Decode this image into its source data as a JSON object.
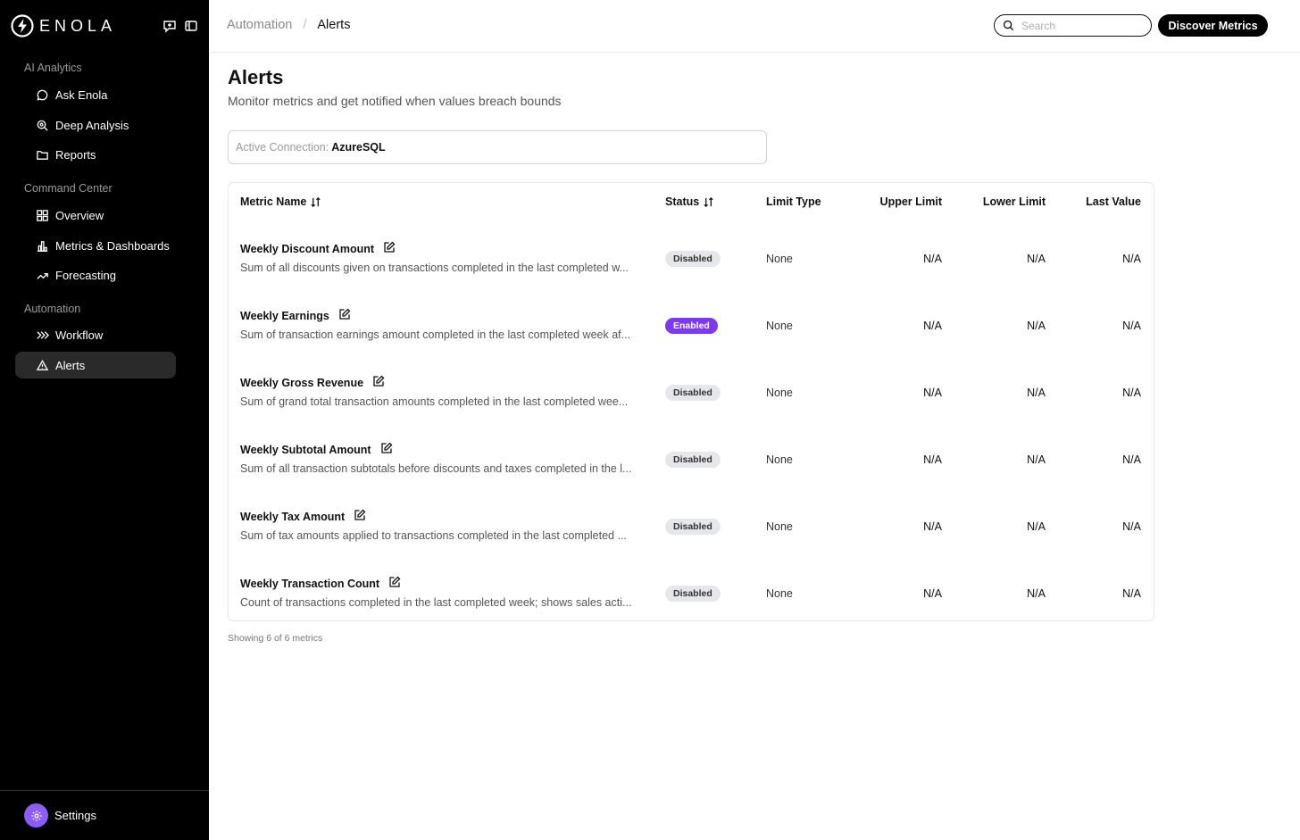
{
  "brand": {
    "name": "ENOLA"
  },
  "sidebar": {
    "sections": [
      {
        "title": "AI Analytics",
        "items": [
          {
            "label": "Ask Enola",
            "icon": "chat-bubble-icon"
          },
          {
            "label": "Deep Analysis",
            "icon": "search-analysis-icon"
          },
          {
            "label": "Reports",
            "icon": "folder-icon"
          }
        ]
      },
      {
        "title": "Command Center",
        "items": [
          {
            "label": "Overview",
            "icon": "grid-icon"
          },
          {
            "label": "Metrics & Dashboards",
            "icon": "bar-chart-icon"
          },
          {
            "label": "Forecasting",
            "icon": "trend-up-icon"
          }
        ]
      },
      {
        "title": "Automation",
        "items": [
          {
            "label": "Workflow",
            "icon": "chevrons-right-icon"
          },
          {
            "label": "Alerts",
            "icon": "warning-triangle-icon",
            "active": true
          }
        ]
      }
    ],
    "settings_label": "Settings"
  },
  "header": {
    "breadcrumb": [
      "Automation",
      "Alerts"
    ],
    "search_placeholder": "Search",
    "discover_label": "Discover Metrics"
  },
  "main": {
    "title": "Alerts",
    "subtitle": "Monitor metrics and get notified when values breach bounds",
    "connection_label": "Active Connection:",
    "connection_value": "AzureSQL",
    "columns": [
      "Metric Name",
      "Status",
      "Limit Type",
      "Upper Limit",
      "Lower Limit",
      "Last Value"
    ],
    "rows": [
      {
        "name": "Weekly Discount Amount",
        "description": "Sum of all discounts given on transactions completed in the last completed w...",
        "status": "Disabled",
        "limit_type": "None",
        "upper": "N/A",
        "lower": "N/A",
        "last": "N/A"
      },
      {
        "name": "Weekly Earnings",
        "description": "Sum of transaction earnings amount completed in the last completed week af...",
        "status": "Enabled",
        "limit_type": "None",
        "upper": "N/A",
        "lower": "N/A",
        "last": "N/A"
      },
      {
        "name": "Weekly Gross Revenue",
        "description": "Sum of grand total transaction amounts completed in the last completed wee...",
        "status": "Disabled",
        "limit_type": "None",
        "upper": "N/A",
        "lower": "N/A",
        "last": "N/A"
      },
      {
        "name": "Weekly Subtotal Amount",
        "description": "Sum of all transaction subtotals before discounts and taxes completed in the l...",
        "status": "Disabled",
        "limit_type": "None",
        "upper": "N/A",
        "lower": "N/A",
        "last": "N/A"
      },
      {
        "name": "Weekly Tax Amount",
        "description": "Sum of tax amounts applied to transactions completed in the last completed ...",
        "status": "Disabled",
        "limit_type": "None",
        "upper": "N/A",
        "lower": "N/A",
        "last": "N/A"
      },
      {
        "name": "Weekly Transaction Count",
        "description": "Count of transactions completed in the last completed week; shows sales acti...",
        "status": "Disabled",
        "limit_type": "None",
        "upper": "N/A",
        "lower": "N/A",
        "last": "N/A"
      }
    ],
    "footer": "Showing 6 of 6 metrics"
  },
  "colors": {
    "accent": "#7c3aed",
    "sidebar_bg": "#000000",
    "avatar": "#8b5cf6"
  }
}
